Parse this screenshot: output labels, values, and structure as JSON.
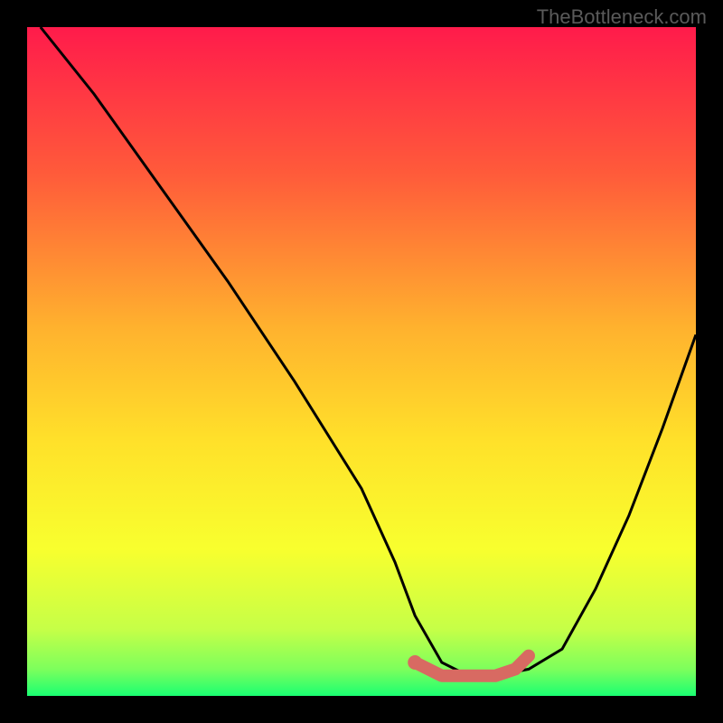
{
  "attribution": "TheBottleneck.com",
  "chart_data": {
    "type": "line",
    "title": "",
    "xlabel": "",
    "ylabel": "",
    "xlim": [
      0,
      100
    ],
    "ylim": [
      0,
      100
    ],
    "series": [
      {
        "name": "bottleneck-curve",
        "x": [
          2,
          10,
          20,
          30,
          40,
          50,
          55,
          58,
          62,
          66,
          70,
          75,
          80,
          85,
          90,
          95,
          100
        ],
        "values": [
          100,
          90,
          76,
          62,
          47,
          31,
          20,
          12,
          5,
          3,
          3,
          4,
          7,
          16,
          27,
          40,
          54
        ]
      },
      {
        "name": "highlight-segment",
        "x": [
          58,
          62,
          66,
          70,
          73,
          75
        ],
        "values": [
          5,
          3,
          3,
          3,
          4,
          6
        ]
      }
    ],
    "gradient_stops": [
      {
        "offset": 0,
        "color": "#ff1b4b"
      },
      {
        "offset": 0.22,
        "color": "#ff5b3a"
      },
      {
        "offset": 0.45,
        "color": "#ffb22e"
      },
      {
        "offset": 0.62,
        "color": "#ffe12a"
      },
      {
        "offset": 0.78,
        "color": "#f8ff2e"
      },
      {
        "offset": 0.9,
        "color": "#c6ff47"
      },
      {
        "offset": 0.96,
        "color": "#7dff5c"
      },
      {
        "offset": 1.0,
        "color": "#1aff72"
      }
    ],
    "highlight_color": "#d86a62",
    "curve_color": "#000000"
  }
}
